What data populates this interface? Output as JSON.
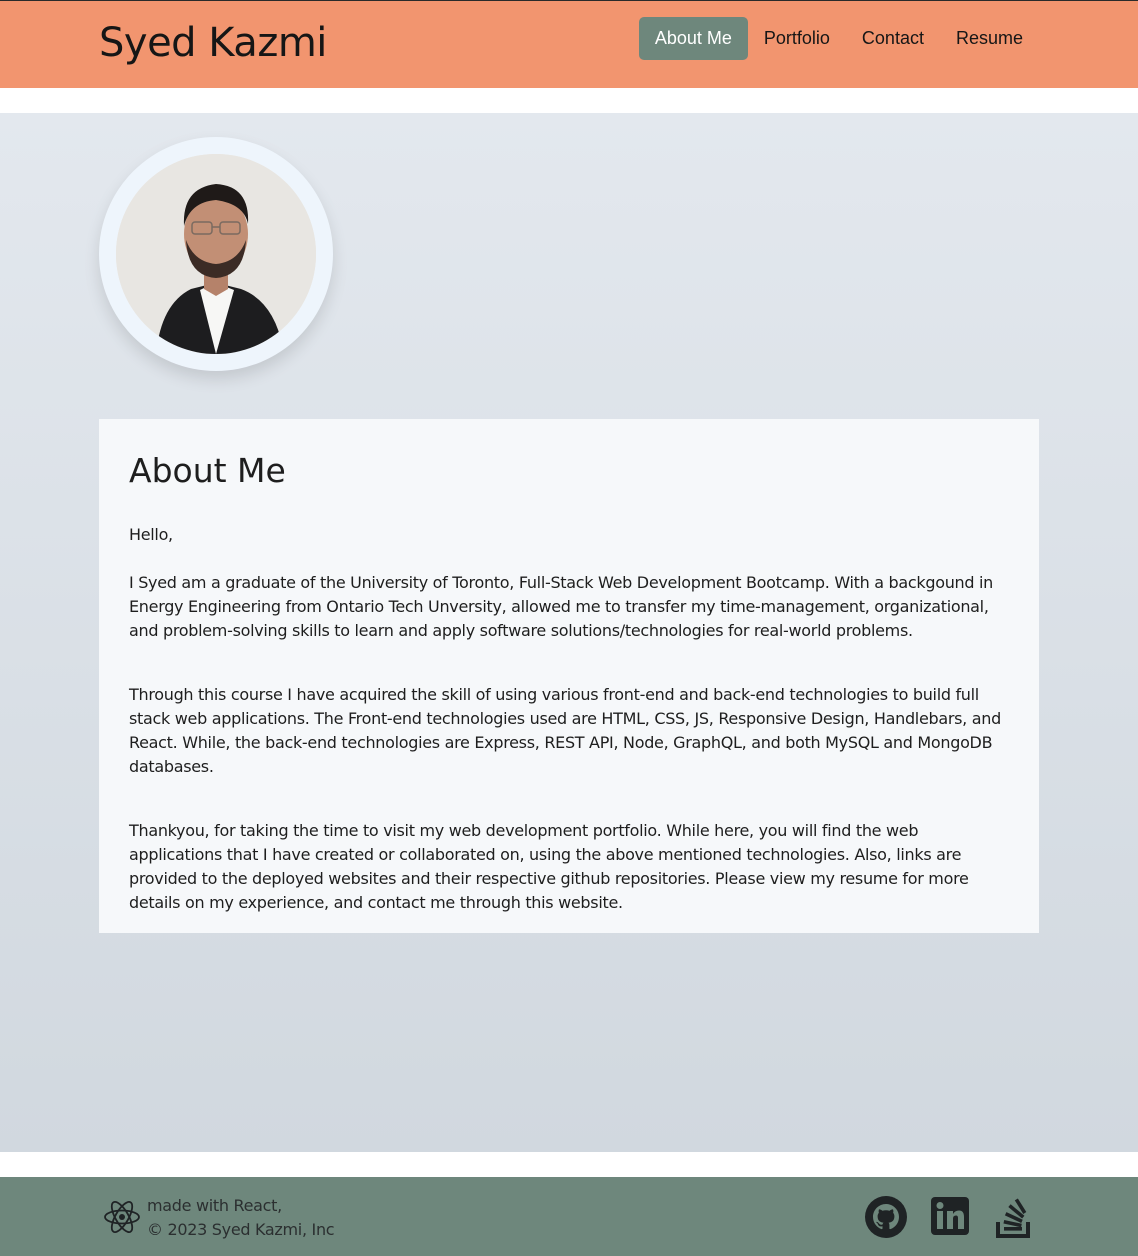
{
  "header": {
    "title": "Syed Kazmi",
    "nav": [
      {
        "label": "About Me",
        "active": true
      },
      {
        "label": "Portfolio",
        "active": false
      },
      {
        "label": "Contact",
        "active": false
      },
      {
        "label": "Resume",
        "active": false
      }
    ]
  },
  "about": {
    "heading": "About Me",
    "greeting": "Hello,",
    "paragraphs": [
      "I Syed am a graduate of the University of Toronto, Full-Stack Web Development Bootcamp. With a backgound in Energy Engineering from Ontario Tech Unversity, allowed me to transfer my time-management, organizational, and problem-solving skills to learn and apply software solutions/technologies for real-world problems.",
      "Through this course I have acquired the skill of using various front-end and back-end technologies to build full stack web applications. The Front-end technologies used are HTML, CSS, JS, Responsive Design, Handlebars, and React. While, the back-end technologies are Express, REST API, Node, GraphQL, and both MySQL and MongoDB databases.",
      "Thankyou, for taking the time to visit my web development portfolio. While here, you will find the web applications that I have created or collaborated on, using the above mentioned technologies. Also, links are provided to the deployed websites and their respective github repositories. Please view my resume for more details on my experience, and contact me through this website."
    ]
  },
  "footer": {
    "made_with": "made with React,",
    "copyright": "© 2023 Syed Kazmi, Inc",
    "social_icons": [
      "github-icon",
      "linkedin-icon",
      "stackoverflow-icon"
    ]
  },
  "colors": {
    "header_bg": "#f2956f",
    "nav_active_bg": "#6e877c",
    "footer_bg": "#6e877c",
    "card_bg": "#f6f8fa"
  }
}
